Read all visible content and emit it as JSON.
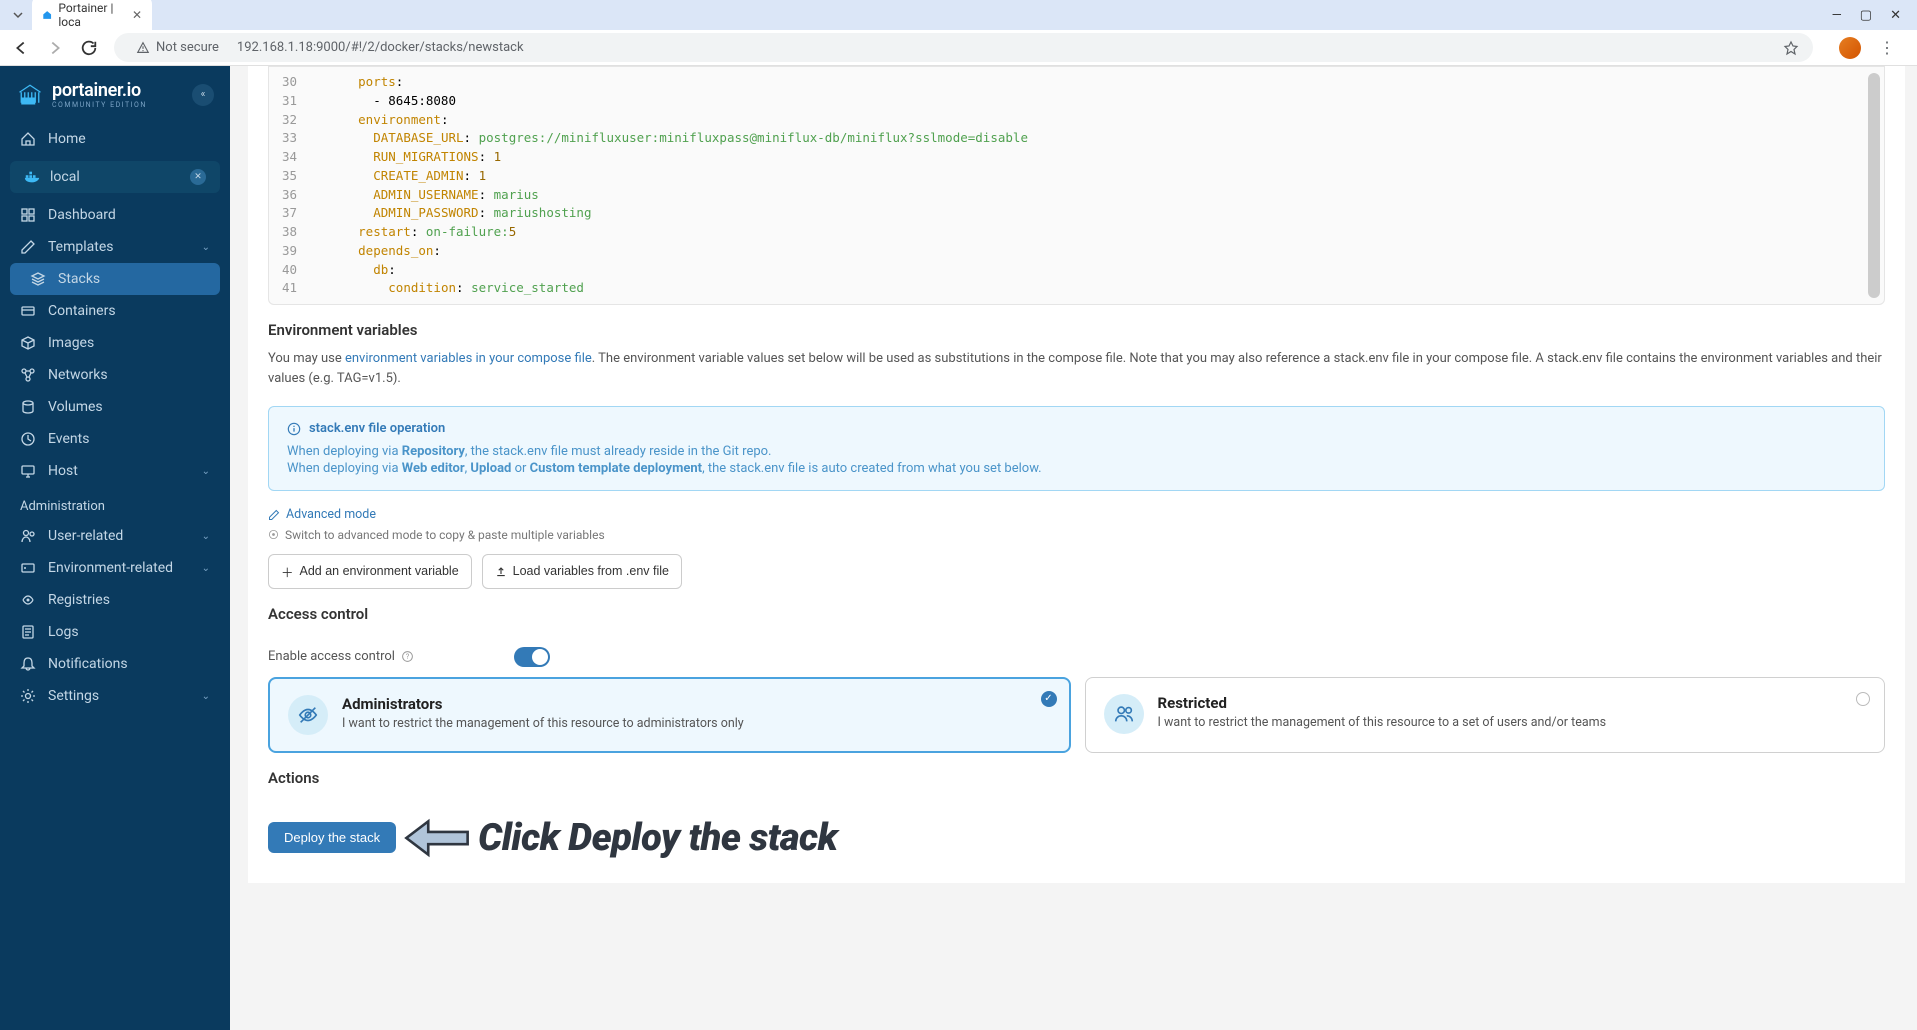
{
  "browser": {
    "tab_title": "Portainer | loca",
    "url": "192.168.1.18:9000/#!/2/docker/stacks/newstack",
    "not_secure": "Not secure"
  },
  "logo": {
    "main": "portainer.io",
    "sub": "COMMUNITY EDITION"
  },
  "sidebar": {
    "home": "Home",
    "env_name": "local",
    "items": [
      {
        "label": "Dashboard",
        "icon": "dashboard"
      },
      {
        "label": "Templates",
        "icon": "templates",
        "chevron": true
      },
      {
        "label": "Stacks",
        "icon": "stacks",
        "active": true
      },
      {
        "label": "Containers",
        "icon": "containers"
      },
      {
        "label": "Images",
        "icon": "images"
      },
      {
        "label": "Networks",
        "icon": "networks"
      },
      {
        "label": "Volumes",
        "icon": "volumes"
      },
      {
        "label": "Events",
        "icon": "events"
      },
      {
        "label": "Host",
        "icon": "host",
        "chevron": true
      }
    ],
    "admin_label": "Administration",
    "admin_items": [
      {
        "label": "User-related",
        "icon": "users",
        "chevron": true
      },
      {
        "label": "Environment-related",
        "icon": "environment",
        "chevron": true
      },
      {
        "label": "Registries",
        "icon": "registries"
      },
      {
        "label": "Logs",
        "icon": "logs"
      },
      {
        "label": "Notifications",
        "icon": "notifications"
      },
      {
        "label": "Settings",
        "icon": "settings",
        "chevron": true
      }
    ]
  },
  "code": [
    {
      "n": 30,
      "indent": 6,
      "key": "ports",
      "colon": ":"
    },
    {
      "n": 31,
      "indent": 8,
      "text": "- 8645:8080"
    },
    {
      "n": 32,
      "indent": 6,
      "key": "environment",
      "colon": ":"
    },
    {
      "n": 33,
      "indent": 8,
      "key": "DATABASE_URL",
      "colon": ": ",
      "val": "postgres://minifluxuser:minifluxpass@miniflux-db/miniflux?sslmode=disable"
    },
    {
      "n": 34,
      "indent": 8,
      "key": "RUN_MIGRATIONS",
      "colon": ": ",
      "num": "1"
    },
    {
      "n": 35,
      "indent": 8,
      "key": "CREATE_ADMIN",
      "colon": ": ",
      "num": "1"
    },
    {
      "n": 36,
      "indent": 8,
      "key": "ADMIN_USERNAME",
      "colon": ": ",
      "val": "marius"
    },
    {
      "n": 37,
      "indent": 8,
      "key": "ADMIN_PASSWORD",
      "colon": ": ",
      "val": "mariushosting"
    },
    {
      "n": 38,
      "indent": 6,
      "key": "restart",
      "colon": ": ",
      "val": "on-failure:",
      "num": "5"
    },
    {
      "n": 39,
      "indent": 6,
      "key": "depends_on",
      "colon": ":"
    },
    {
      "n": 40,
      "indent": 8,
      "key": "db",
      "colon": ":"
    },
    {
      "n": 41,
      "indent": 10,
      "key": "condition",
      "colon": ": ",
      "val": "service_started"
    }
  ],
  "env": {
    "title": "Environment variables",
    "help1": "You may use ",
    "help_link": "environment variables in your compose file",
    "help2": ". The environment variable values set below will be used as substitutions in the compose file. Note that you may also reference a stack.env file in your compose file. A stack.env file contains the environment variables and their values (e.g. TAG=v1.5).",
    "info_title": "stack.env file operation",
    "info_l1a": "When deploying via ",
    "info_l1b": "Repository",
    "info_l1c": ", the stack.env file must already reside in the Git repo.",
    "info_l2a": "When deploying via ",
    "info_l2b": "Web editor",
    "info_l2c": ", ",
    "info_l2d": "Upload",
    "info_l2e": " or ",
    "info_l2f": "Custom template deployment",
    "info_l2g": ", the stack.env file is auto created from what you set below.",
    "advanced": "Advanced mode",
    "hint": "Switch to advanced mode to copy & paste multiple variables",
    "add_btn": "Add an environment variable",
    "load_btn": "Load variables from .env file"
  },
  "access": {
    "title": "Access control",
    "enable_label": "Enable access control",
    "admin_title": "Administrators",
    "admin_desc": "I want to restrict the management of this resource to administrators only",
    "restricted_title": "Restricted",
    "restricted_desc": "I want to restrict the management of this resource to a set of users and/or teams"
  },
  "actions": {
    "title": "Actions",
    "deploy": "Deploy the stack"
  },
  "annotation": "Click Deploy the stack"
}
